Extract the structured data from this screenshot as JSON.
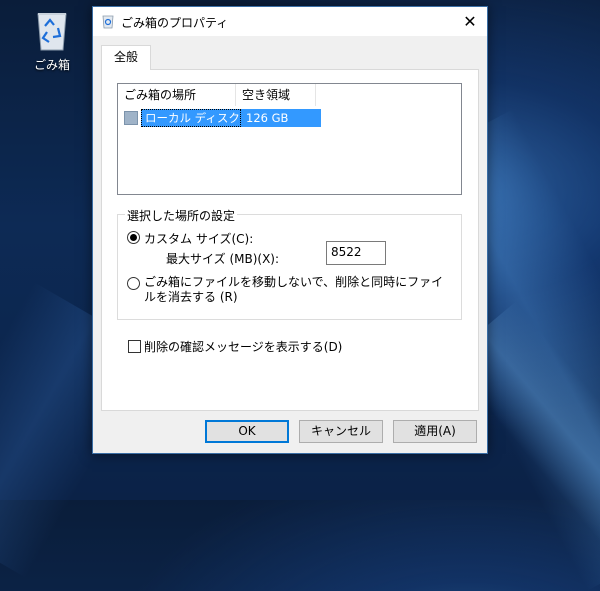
{
  "desktop": {
    "recycle_bin_label": "ごみ箱"
  },
  "dialog": {
    "title": "ごみ箱のプロパティ",
    "close_glyph": "✕",
    "tab": "全般",
    "list": {
      "columns": [
        "ごみ箱の場所",
        "空き領域"
      ],
      "rows": [
        {
          "location": "ローカル ディスク (C:)",
          "free_space": "126 GB",
          "selected": true
        }
      ]
    },
    "group": {
      "label": "選択した場所の設定",
      "custom_size_label": "カスタム サイズ(C):",
      "max_size_label": "最大サイズ (MB)(X):",
      "max_size_value": "8522",
      "delete_immediately_label": "ごみ箱にファイルを移動しないで、削除と同時にファイルを消去する (R)"
    },
    "confirm_checkbox_label": "削除の確認メッセージを表示する(D)",
    "buttons": {
      "ok": "OK",
      "cancel": "キャンセル",
      "apply": "適用(A)"
    }
  },
  "colors": {
    "selection": "#3399ff",
    "accent_border": "#0078d7"
  },
  "icons": [
    "recycle-bin-icon",
    "close-icon",
    "drive-icon"
  ]
}
